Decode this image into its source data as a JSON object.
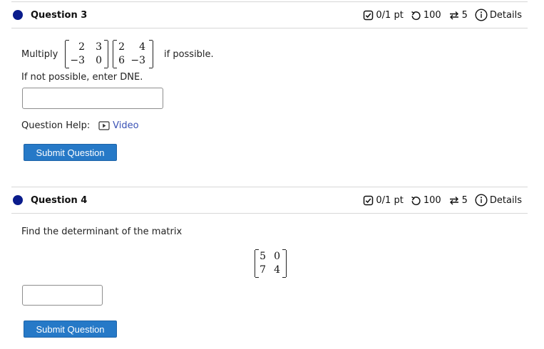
{
  "questions": [
    {
      "title": "Question 3",
      "score": "0/1 pt",
      "tries": "100",
      "attempts": "5",
      "details_label": "Details",
      "prompt_prefix": "Multiply",
      "prompt_suffix": "if possible.",
      "prompt_note": "If not possible, enter DNE.",
      "matrix_a": [
        "2",
        "3",
        "−3",
        "0"
      ],
      "matrix_b": [
        "2",
        "4",
        "6",
        "−3"
      ],
      "answer_value": "",
      "help_label": "Question Help:",
      "video_label": "Video",
      "submit_label": "Submit Question"
    },
    {
      "title": "Question 4",
      "score": "0/1 pt",
      "tries": "100",
      "attempts": "5",
      "details_label": "Details",
      "prompt": "Find the determinant of the matrix",
      "matrix": [
        "5",
        "0",
        "7",
        "4"
      ],
      "answer_value": "",
      "submit_label": "Submit Question"
    }
  ],
  "colors": {
    "status_dot": "#0a1c8c",
    "submit_bg": "#2679c7",
    "link": "#3a52b5"
  },
  "icons": {
    "score": "checkbox-icon",
    "tries": "retry-icon",
    "attempts": "swap-icon",
    "details": "info-icon",
    "video": "play-icon"
  }
}
